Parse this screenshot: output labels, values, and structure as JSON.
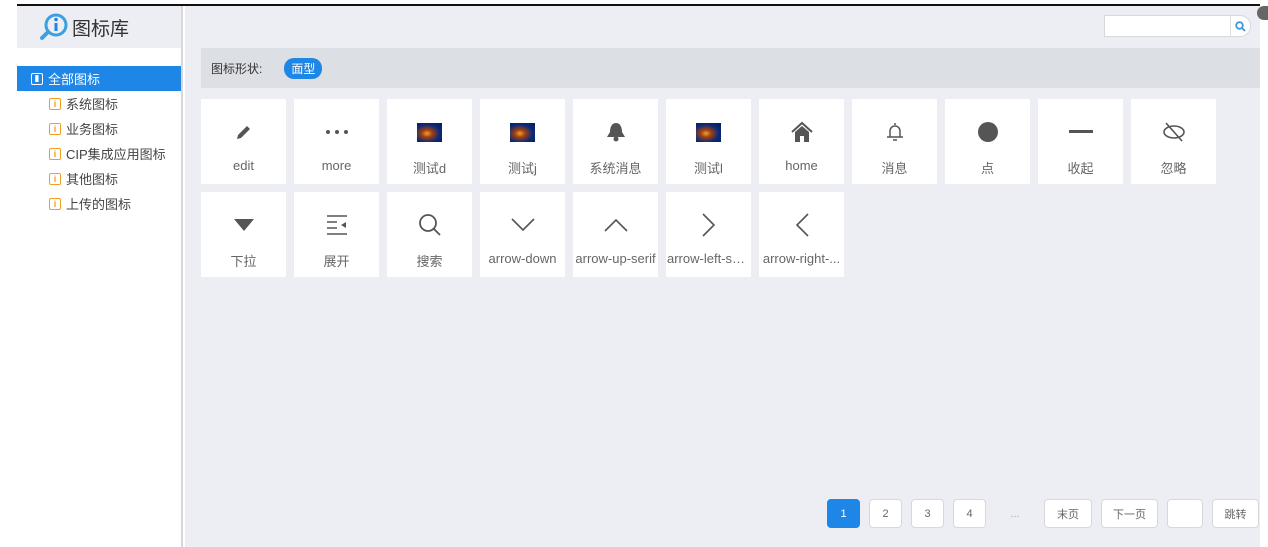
{
  "app": {
    "title": "图标库"
  },
  "sidebar": {
    "items": [
      {
        "label": "全部图标",
        "active": true
      },
      {
        "label": "系统图标"
      },
      {
        "label": "业务图标"
      },
      {
        "label": "CIP集成应用图标"
      },
      {
        "label": "其他图标"
      },
      {
        "label": "上传的图标"
      }
    ]
  },
  "search": {
    "value": "",
    "placeholder": ""
  },
  "filter": {
    "label": "图标形状:",
    "selected": "面型"
  },
  "icons": [
    {
      "label": "edit",
      "icon": "pencil"
    },
    {
      "label": "more",
      "icon": "dots"
    },
    {
      "label": "测试d",
      "icon": "image"
    },
    {
      "label": "测试j",
      "icon": "image"
    },
    {
      "label": "系统消息",
      "icon": "bell-filled"
    },
    {
      "label": "测试l",
      "icon": "image"
    },
    {
      "label": "home",
      "icon": "home"
    },
    {
      "label": "消息",
      "icon": "bell"
    },
    {
      "label": "点",
      "icon": "dot"
    },
    {
      "label": "收起",
      "icon": "minus"
    },
    {
      "label": "忽略",
      "icon": "eye-off"
    },
    {
      "label": "下拉",
      "icon": "triangle-down"
    },
    {
      "label": "展开",
      "icon": "expand"
    },
    {
      "label": "搜索",
      "icon": "search"
    },
    {
      "label": "arrow-down",
      "icon": "chevron-down"
    },
    {
      "label": "arrow-up-serif",
      "icon": "chevron-up"
    },
    {
      "label": "arrow-left-se...",
      "icon": "chevron-right"
    },
    {
      "label": "arrow-right-...",
      "icon": "chevron-left"
    }
  ],
  "pagination": {
    "pages": [
      "1",
      "2",
      "3",
      "4"
    ],
    "current": "1",
    "ellipsis": "...",
    "last": "末页",
    "next": "下一页",
    "jump_value": "",
    "jump": "跳转"
  },
  "colors": {
    "accent": "#1e86e6",
    "bg": "#eceef3",
    "nav_icon": "#f0a020"
  }
}
